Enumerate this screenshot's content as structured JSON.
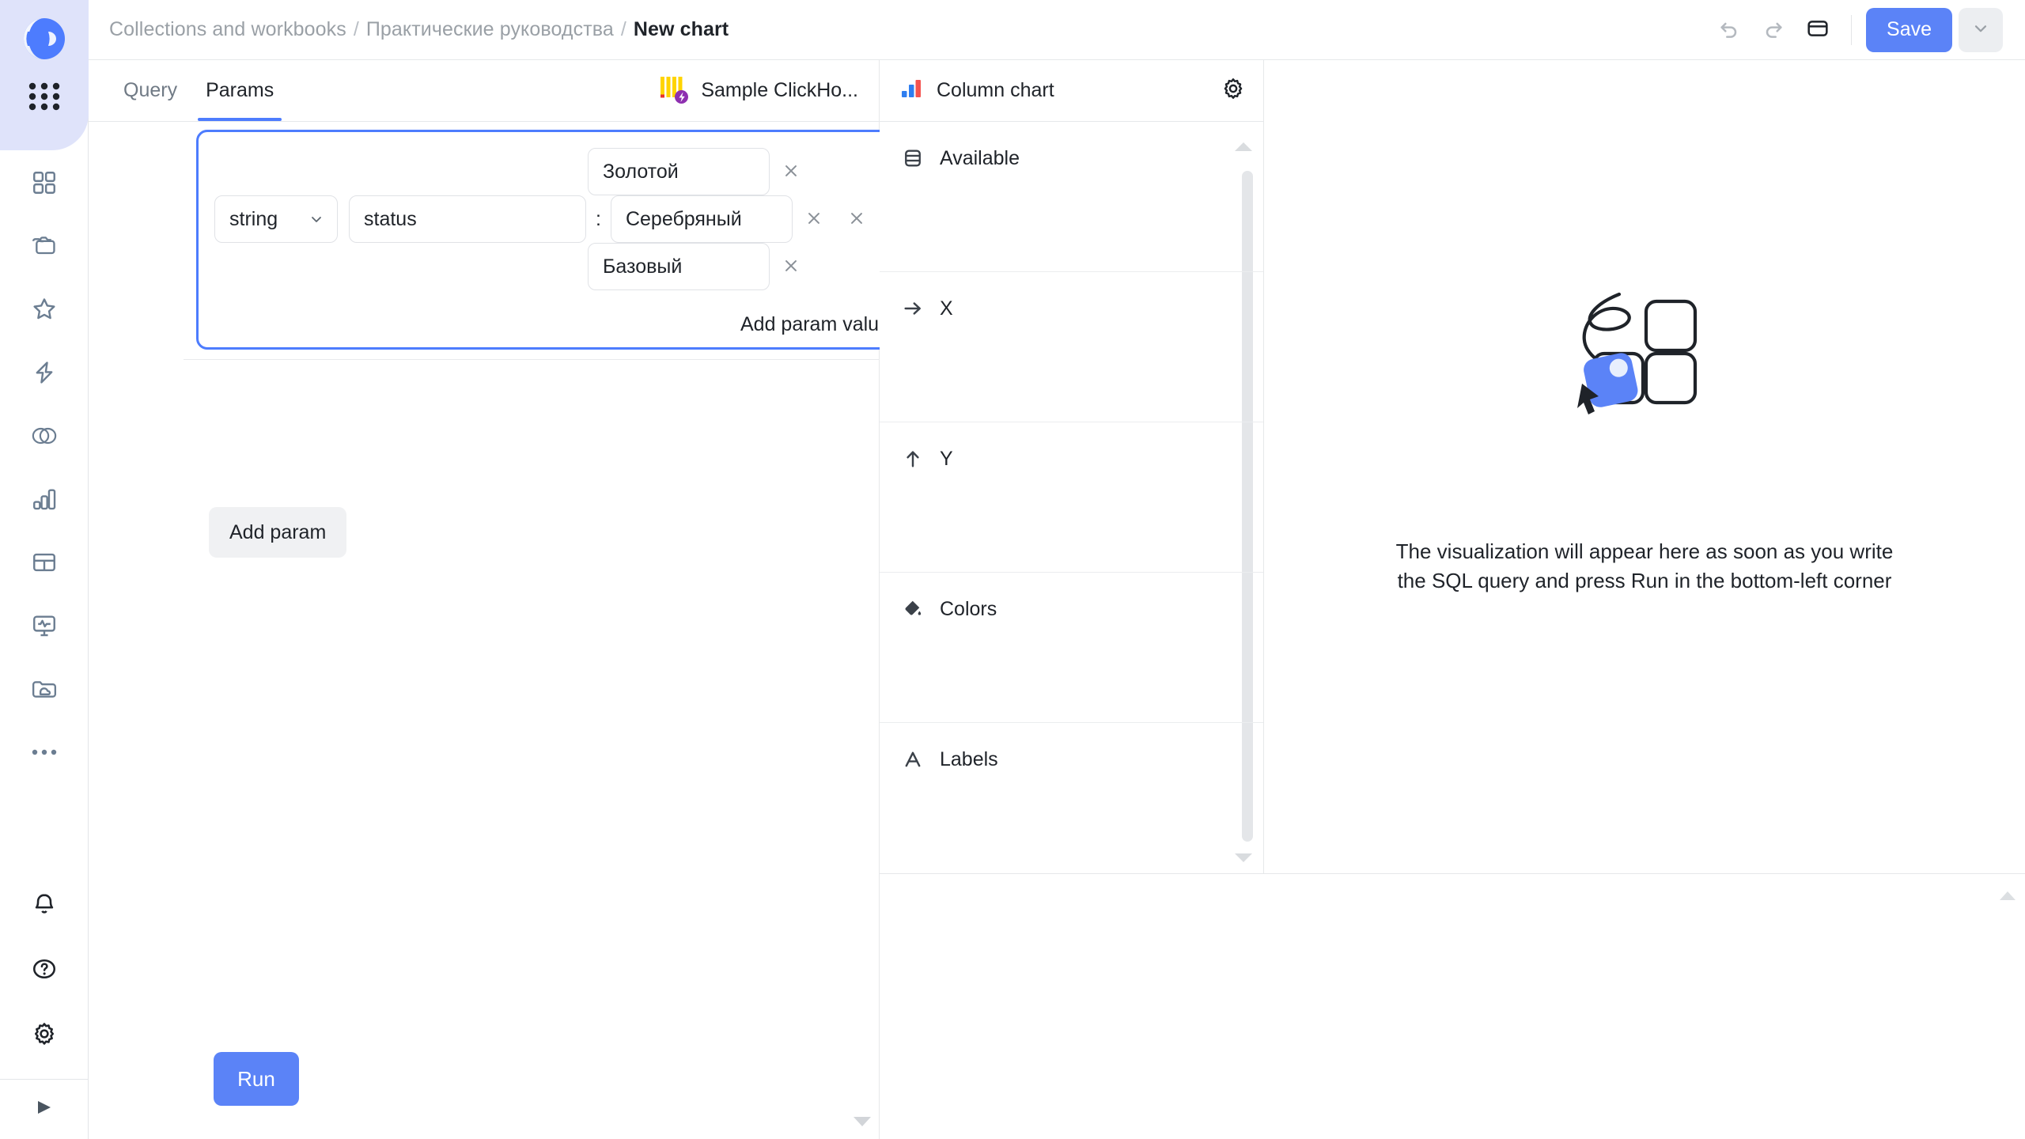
{
  "app": {
    "logo_icon": "datalens-logo-icon",
    "grid_icon": "apps-grid-icon"
  },
  "sidebar": {
    "nav_items": [
      {
        "label": "Dashboards",
        "icon": "dashboards-grid-icon"
      },
      {
        "label": "Collections",
        "icon": "folders-icon"
      },
      {
        "label": "Favorites",
        "icon": "star-icon"
      },
      {
        "label": "Connections",
        "icon": "lightning-icon"
      },
      {
        "label": "Datasets",
        "icon": "circles-overlap-icon"
      },
      {
        "label": "Charts",
        "icon": "bar-chart-icon"
      },
      {
        "label": "Tables",
        "icon": "table-icon"
      },
      {
        "label": "Monitoring",
        "icon": "monitor-pulse-icon"
      },
      {
        "label": "Files",
        "icon": "folder-cloud-icon"
      },
      {
        "label": "More",
        "icon": "ellipsis-icon"
      }
    ],
    "bottom_items": [
      {
        "label": "Notifications",
        "icon": "bell-icon"
      },
      {
        "label": "Help",
        "icon": "question-circle-icon"
      },
      {
        "label": "Settings",
        "icon": "gear-icon"
      }
    ],
    "footer": {
      "label": "Expand",
      "icon": "play-triangle-icon"
    }
  },
  "header": {
    "breadcrumbs": [
      {
        "label": "Collections and workbooks",
        "current": false
      },
      {
        "label": "Практические руководства",
        "current": false
      },
      {
        "label": "New chart",
        "current": true
      }
    ],
    "separator": "/",
    "undo_icon": "undo-arrow-icon",
    "redo_icon": "redo-arrow-icon",
    "panel_icon": "panel-layout-icon",
    "save_label": "Save",
    "save_caret_icon": "chevron-down-icon",
    "accent_color": "#5b83f7"
  },
  "query_pane": {
    "tabs": [
      {
        "label": "Query",
        "active": false
      },
      {
        "label": "Params",
        "active": true
      }
    ],
    "connection": {
      "label": "Sample ClickHo...",
      "icon": "clickhouse-logo-icon"
    },
    "param": {
      "type_value": "string",
      "type_caret_icon": "chevron-down-icon",
      "name_value": "status",
      "separator": ":",
      "values": [
        {
          "text": "Золотой",
          "remove_icon": "close-icon"
        },
        {
          "text": "Серебряный",
          "remove_icon": "close-icon"
        },
        {
          "text": "Базовый",
          "remove_icon": "close-icon"
        }
      ],
      "remove_param_icon": "close-icon",
      "add_value_label": "Add param value"
    },
    "add_param_label": "Add param",
    "run_label": "Run",
    "scroll_up_icon": "scroll-up-arrow-icon",
    "scroll_down_icon": "scroll-down-arrow-icon"
  },
  "viz_pane": {
    "chart_type": "Column chart",
    "chart_type_icon": "column-chart-icon",
    "settings_icon": "gear-icon",
    "sections": [
      {
        "label": "Available",
        "icon": "dataset-fields-icon"
      },
      {
        "label": "X",
        "icon": "arrow-right-icon"
      },
      {
        "label": "Y",
        "icon": "arrow-up-icon"
      },
      {
        "label": "Colors",
        "icon": "paint-bucket-icon"
      },
      {
        "label": "Labels",
        "icon": "letter-a-icon"
      }
    ],
    "scroll_up_icon": "scroll-up-arrow-icon",
    "scroll_down_icon": "scroll-down-arrow-icon"
  },
  "preview": {
    "illustration_icon": "drag-tiles-illustration",
    "line1": "The visualization will appear here as soon as you write",
    "line2": "the SQL query and press Run in the bottom-left corner"
  },
  "bottom_panel": {
    "scroll_up_icon": "scroll-up-arrow-icon"
  }
}
